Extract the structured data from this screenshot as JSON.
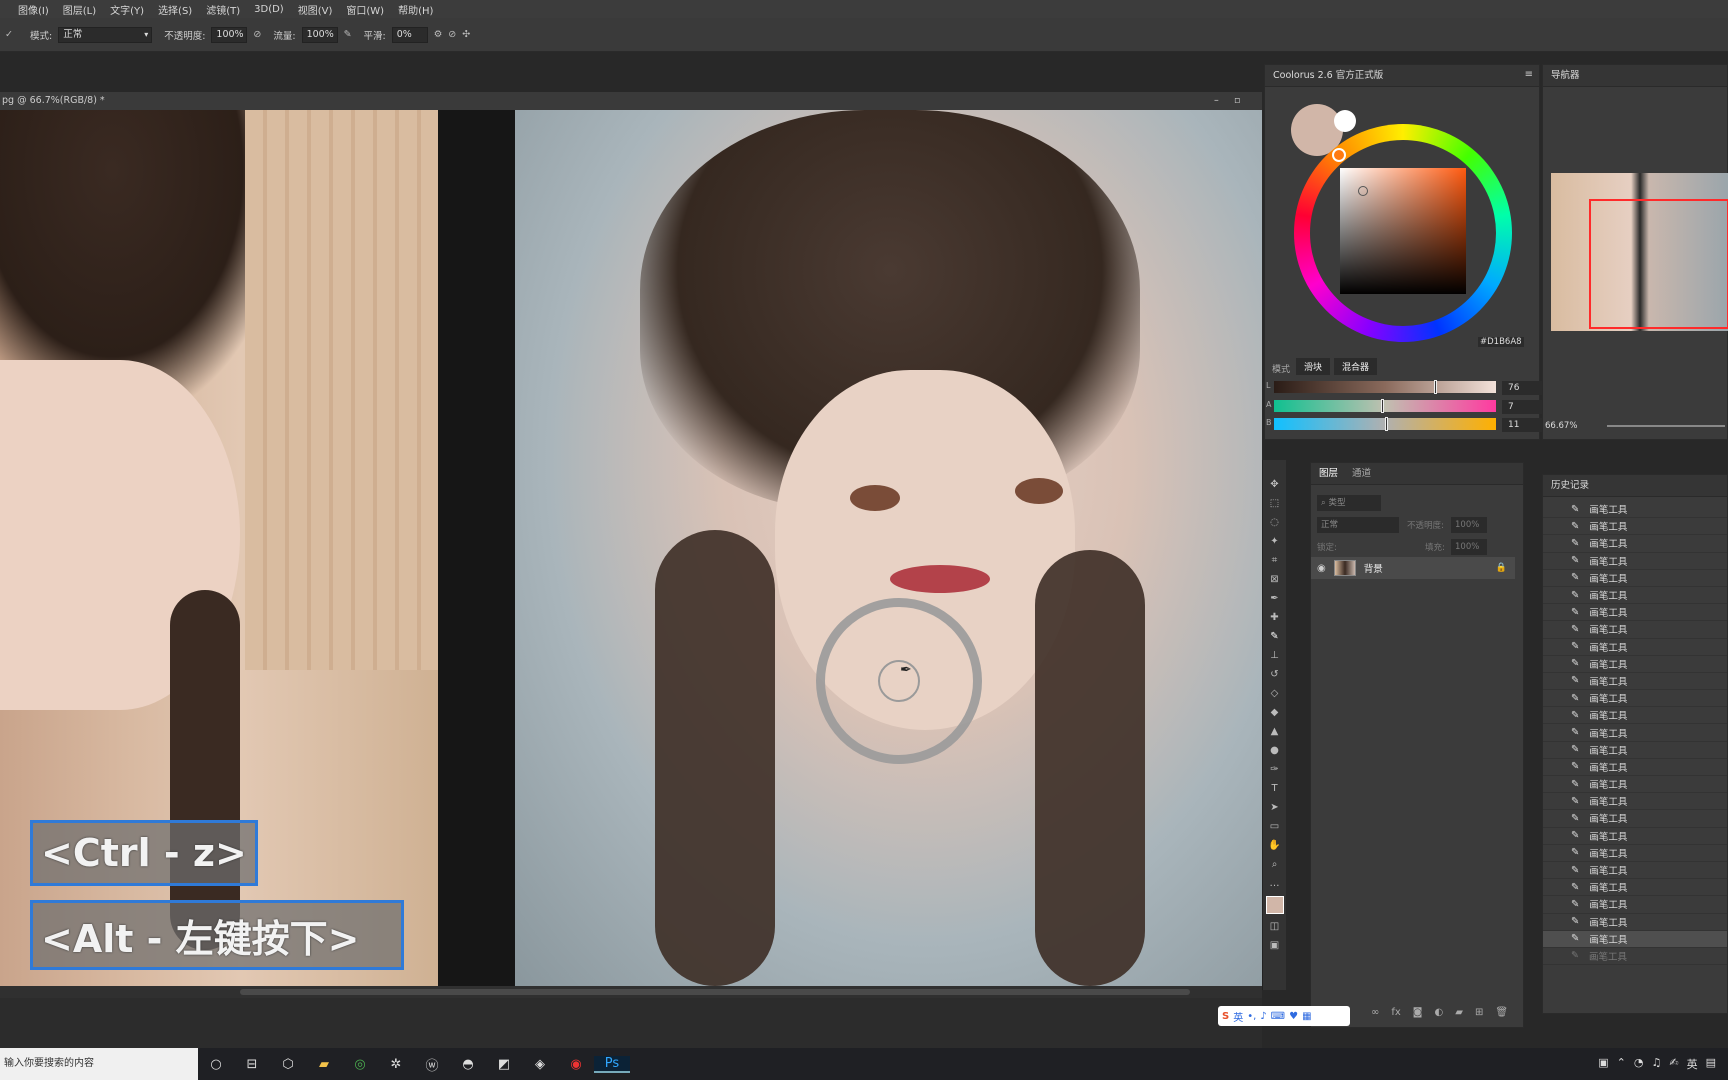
{
  "menu": [
    "图像(I)",
    "图层(L)",
    "文字(Y)",
    "选择(S)",
    "滤镜(T)",
    "3D(D)",
    "视图(V)",
    "窗口(W)",
    "帮助(H)"
  ],
  "options": {
    "mode_label": "模式:",
    "mode_value": "正常",
    "opacity_label": "不透明度:",
    "opacity_value": "100%",
    "flow_label": "流量:",
    "flow_value": "100%",
    "smooth_label": "平滑:",
    "smooth_value": "0%"
  },
  "document": {
    "tab_title": "pg @ 66.7%(RGB/8) *"
  },
  "overlays": {
    "undo_shortcut": "<Ctrl - z>",
    "alt_shortcut": "<Alt - 左键按下>"
  },
  "coolorus": {
    "title": "Coolorus 2.6 官方正式版",
    "hex": "#D1B6A8",
    "mode_label": "模式",
    "tab_slider": "滑块",
    "tab_mixer": "混合器",
    "sliders": [
      {
        "label": "L",
        "value": "76",
        "fraction": 0.72
      },
      {
        "label": "A",
        "value": "7",
        "fraction": 0.48
      },
      {
        "label": "B",
        "value": "11",
        "fraction": 0.5
      }
    ],
    "colors": {
      "current": "#D1B6A8",
      "previous": "#ffffff"
    }
  },
  "navigator": {
    "title": "导航器",
    "zoom": "66.67%"
  },
  "layers": {
    "tab_layers": "图层",
    "tab_channels": "通道",
    "filter_placeholder": "类型",
    "blend_mode": "正常",
    "opacity_label": "不透明度:",
    "opacity_value": "100%",
    "lock_label": "锁定:",
    "fill_label": "填充:",
    "fill_value": "100%",
    "items": [
      {
        "name": "背景",
        "visible": true,
        "locked": true
      }
    ]
  },
  "history": {
    "title": "历史记录",
    "items": [
      "画笔工具",
      "画笔工具",
      "画笔工具",
      "画笔工具",
      "画笔工具",
      "画笔工具",
      "画笔工具",
      "画笔工具",
      "画笔工具",
      "画笔工具",
      "画笔工具",
      "画笔工具",
      "画笔工具",
      "画笔工具",
      "画笔工具",
      "画笔工具",
      "画笔工具",
      "画笔工具",
      "画笔工具",
      "画笔工具",
      "画笔工具",
      "画笔工具",
      "画笔工具",
      "画笔工具",
      "画笔工具",
      "画笔工具"
    ],
    "selected_index": 25,
    "dimmed_last": "画笔工具"
  },
  "ime": {
    "lang": "英"
  },
  "taskbar": {
    "search_placeholder": "输入你要搜索的内容",
    "tray_lang": "英"
  }
}
